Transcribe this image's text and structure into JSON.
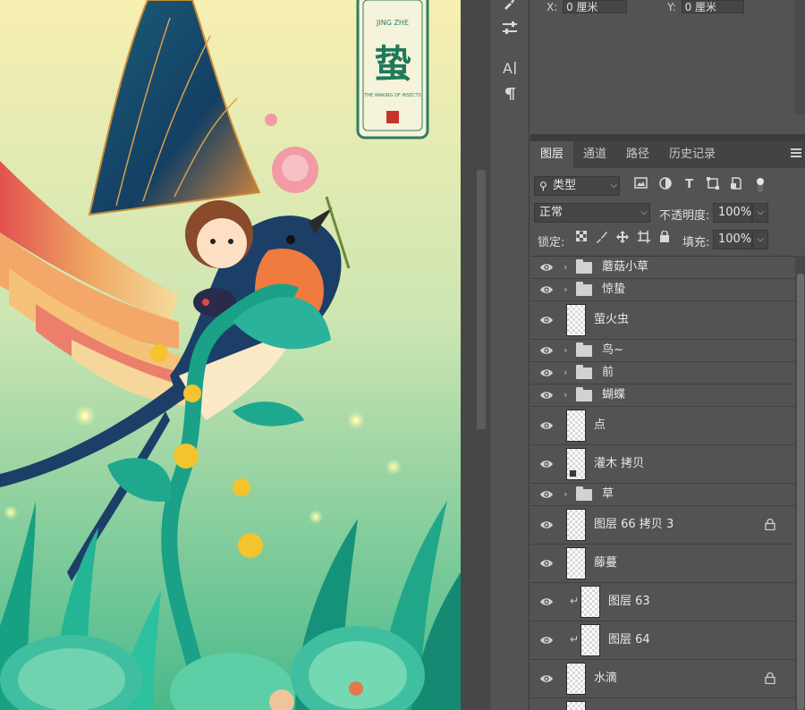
{
  "artwork": {
    "title_pinyin": "JING ZHE",
    "title_char": "蛰",
    "subtitle": "THE WAKING OF INSECTS",
    "seal": "惊蛰"
  },
  "properties": {
    "x_label": "X:",
    "x_value": "0 厘米",
    "y_label": "Y:",
    "y_value": "0 厘米"
  },
  "layers_panel": {
    "tabs": [
      "图层",
      "通道",
      "路径",
      "历史记录"
    ],
    "filter_kind": "类型",
    "blend_mode": "正常",
    "opacity_label": "不透明度:",
    "opacity_value": "100%",
    "lock_label": "锁定:",
    "fill_label": "填充:",
    "fill_value": "100%",
    "layers": [
      {
        "name": "蘑菇小草",
        "type": "group",
        "locked": false,
        "clip": false
      },
      {
        "name": "惊蛰",
        "type": "group",
        "locked": false,
        "clip": false
      },
      {
        "name": "萤火虫",
        "type": "layer",
        "locked": false,
        "clip": false
      },
      {
        "name": "鸟~",
        "type": "group",
        "locked": false,
        "clip": false
      },
      {
        "name": "前",
        "type": "group",
        "locked": false,
        "clip": false
      },
      {
        "name": "蝴蝶",
        "type": "group",
        "locked": false,
        "clip": false
      },
      {
        "name": "点",
        "type": "layer",
        "locked": false,
        "clip": false
      },
      {
        "name": "灌木 拷贝",
        "type": "smart",
        "locked": false,
        "clip": false
      },
      {
        "name": "草",
        "type": "group",
        "locked": false,
        "clip": false
      },
      {
        "name": "图层 66 拷贝 3",
        "type": "layer",
        "locked": true,
        "clip": false
      },
      {
        "name": "藤蔓",
        "type": "layer",
        "locked": false,
        "clip": false
      },
      {
        "name": "图层 63",
        "type": "layer",
        "locked": false,
        "clip": true
      },
      {
        "name": "图层 64",
        "type": "layer",
        "locked": false,
        "clip": true
      },
      {
        "name": "水滴",
        "type": "layer",
        "locked": true,
        "clip": false
      },
      {
        "name": "",
        "type": "layer",
        "locked": false,
        "clip": false
      }
    ]
  },
  "colors": {
    "panel_bg": "#535353",
    "tab_bar_bg": "#434343",
    "canvas_bg_top": "#f7eeb0",
    "canvas_bg_bottom": "#4fbf8e",
    "title_green": "#1f7a5a"
  },
  "icons": [
    "brush-icon",
    "adjust-icon",
    "character-icon",
    "paragraph-icon",
    "eye-icon",
    "folder-icon",
    "lock-icon",
    "menu-icon"
  ]
}
